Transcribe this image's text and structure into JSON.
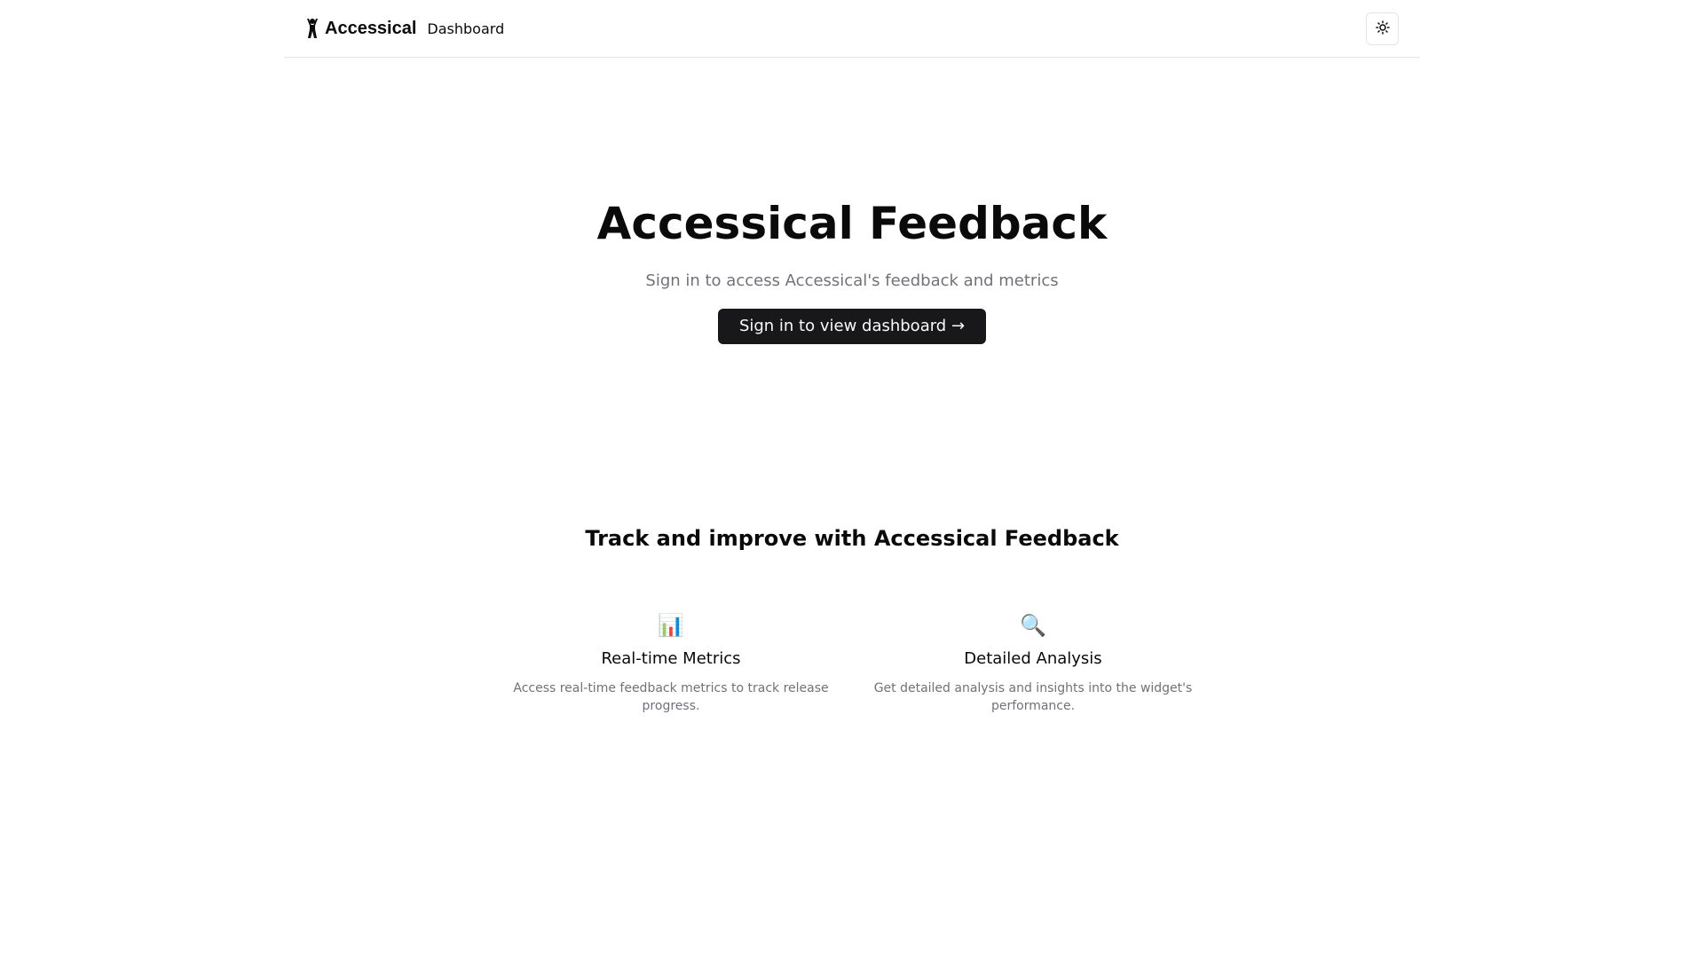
{
  "header": {
    "brand_name": "Accessical",
    "brand_icon": "accessibility-figure-icon",
    "nav_link": "Dashboard",
    "theme_toggle_icon": "sun-icon"
  },
  "hero": {
    "title": "Accessical Feedback",
    "subtitle": "Sign in to access Accessical's feedback and metrics",
    "cta_label": "Sign in to view dashboard →"
  },
  "features": {
    "title": "Track and improve with Accessical Feedback",
    "items": [
      {
        "icon": "bar-chart-icon",
        "glyph": "📊",
        "name": "Real-time Metrics",
        "description": "Access real-time feedback metrics to track release progress."
      },
      {
        "icon": "magnifying-glass-icon",
        "glyph": "🔍",
        "name": "Detailed Analysis",
        "description": "Get detailed analysis and insights into the widget's performance."
      }
    ]
  },
  "colors": {
    "primary": "#18181b",
    "primary_text": "#fafafa",
    "muted_text": "#71717a",
    "border": "#e4e4e7",
    "foreground": "#0a0a0a",
    "background": "#ffffff"
  }
}
